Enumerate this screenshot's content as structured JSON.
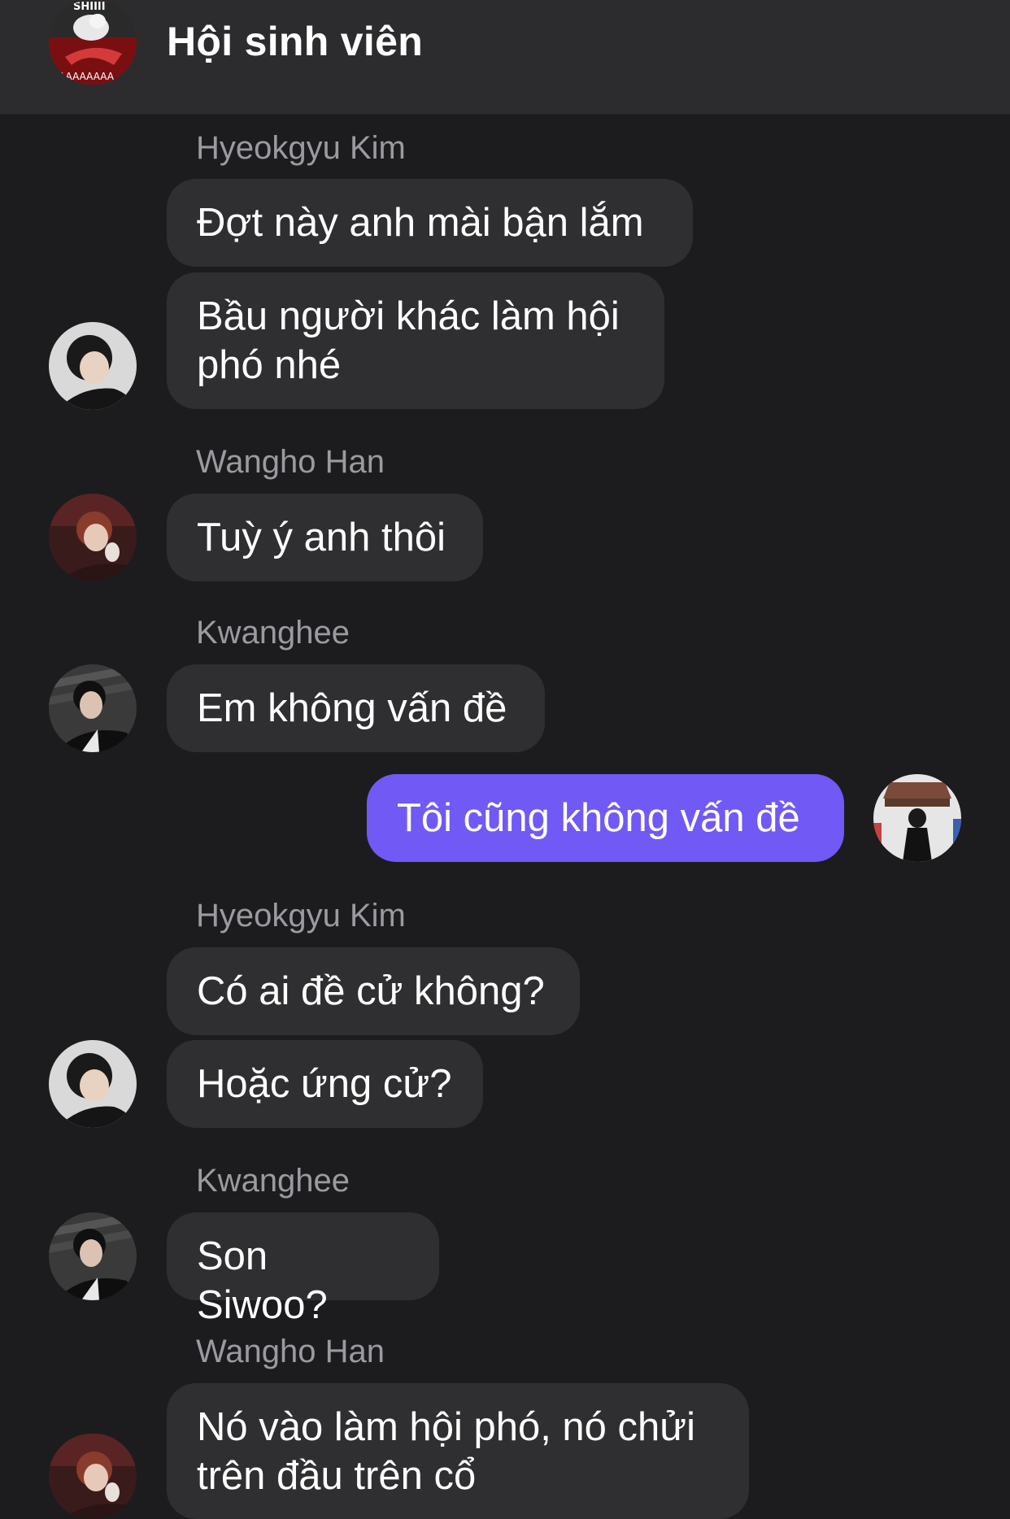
{
  "header": {
    "title": "Hội sinh viên",
    "avatar_text_top": "SHIIII",
    "avatar_text_bottom": "AAAAAAAA"
  },
  "messages": [
    {
      "sender": "Hyeokgyu Kim",
      "bubbles": [
        "Đợt này anh mài bận lắm",
        "Bầu người khác làm hội\nphó nhé"
      ]
    },
    {
      "sender": "Wangho Han",
      "bubbles": [
        "Tuỳ ý anh thôi"
      ]
    },
    {
      "sender": "Kwanghee",
      "bubbles": [
        "Em không vấn đề"
      ]
    },
    {
      "sender": "",
      "mine": true,
      "bubbles": [
        "Tôi cũng không vấn đề"
      ]
    },
    {
      "sender": "Hyeokgyu Kim",
      "bubbles": [
        "Có ai đề cử không?",
        "Hoặc ứng cử?"
      ]
    },
    {
      "sender": "Kwanghee",
      "bubbles": [
        "Son Siwoo?"
      ]
    },
    {
      "sender": "Wangho Han",
      "bubbles": [
        "Nó vào làm hội phó, nó chửi\ntrên đầu trên cổ"
      ]
    }
  ],
  "colors": {
    "background": "#1c1c1e",
    "header": "#2c2c2e",
    "bubble_incoming": "#2f2f31",
    "bubble_outgoing": "#7159f5",
    "sender_name": "#9a9aa0"
  }
}
